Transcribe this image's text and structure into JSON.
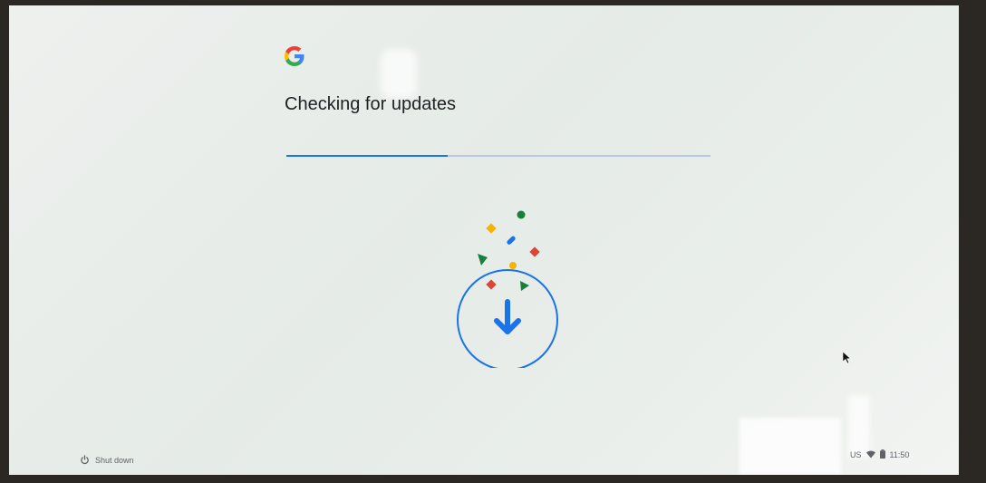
{
  "title": "Checking for updates",
  "progress": 0.38,
  "shelf": {
    "shutdown_label": "Shut down",
    "ime_label": "US",
    "time": "11:50"
  },
  "colors": {
    "accent": "#1a73e8",
    "google_blue": "#4285f4",
    "google_red": "#db4437",
    "google_yellow": "#f4b400",
    "google_green": "#0f9d58"
  },
  "icons": [
    "google-logo-icon",
    "download-arrow-icon",
    "power-icon",
    "wifi-icon",
    "battery-icon",
    "mouse-cursor-icon"
  ]
}
